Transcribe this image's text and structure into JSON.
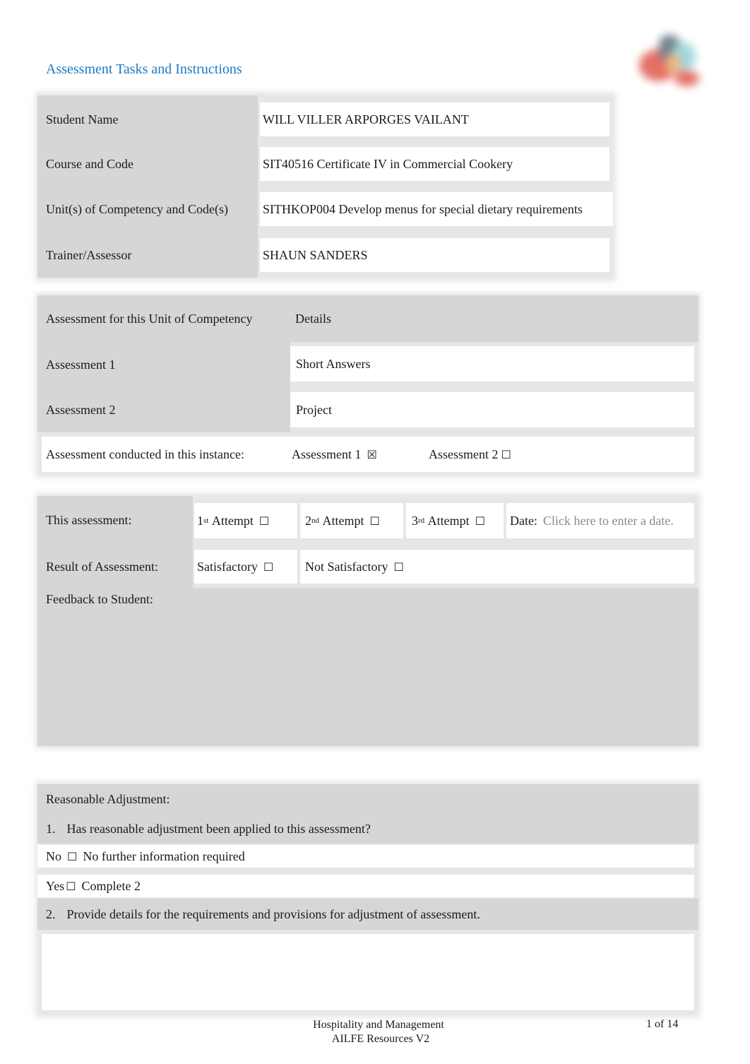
{
  "header": {
    "title": "Assessment Tasks and Instructions",
    "logo_icon": "organisation-logo"
  },
  "details_table": {
    "rows": [
      {
        "label": "Student Name",
        "value": "WILL VILLER ARPORGES VAILANT"
      },
      {
        "label": "Course and Code",
        "value": "SIT40516 Certificate IV in Commercial Cookery"
      },
      {
        "label": "Unit(s) of Competency and Code(s)",
        "value": "SITHKOP004 Develop menus for special dietary requirements"
      },
      {
        "label": "Trainer/Assessor",
        "value": "SHAUN SANDERS"
      }
    ]
  },
  "assessment_table": {
    "header": {
      "label": "Assessment for this Unit of Competency",
      "value": "Details"
    },
    "rows": [
      {
        "label": "Assessment 1",
        "value": "Short Answers"
      },
      {
        "label": "Assessment 2",
        "value": "Project"
      }
    ],
    "conducted": {
      "label": "Assessment conducted in this instance:",
      "options": [
        {
          "label": "Assessment 1",
          "checked": true,
          "box": "☒"
        },
        {
          "label": "Assessment 2",
          "checked": false,
          "box": "☐"
        }
      ]
    }
  },
  "result_table": {
    "attempt_label": "This assessment:",
    "attempts": [
      {
        "num": "1",
        "sup": "st",
        "label": "Attempt",
        "checked": false,
        "box": "☐"
      },
      {
        "num": "2",
        "sup": "nd",
        "label": "Attempt",
        "checked": false,
        "box": "☐"
      },
      {
        "num": "3",
        "sup": "rd",
        "label": "Attempt",
        "checked": false,
        "box": "☐"
      }
    ],
    "date_label": "Date:",
    "date_placeholder": "Click here to enter a date.",
    "result_label": "Result of Assessment:",
    "results": [
      {
        "label": "Satisfactory",
        "checked": false,
        "box": "☐"
      },
      {
        "label": "Not Satisfactory",
        "checked": false,
        "box": "☐"
      }
    ],
    "feedback_label": "Feedback to Student:",
    "feedback_value": ""
  },
  "adjustment_table": {
    "title": "Reasonable Adjustment:",
    "q1": {
      "num": "1.",
      "text": "Has reasonable adjustment been applied to this assessment?"
    },
    "no_option": {
      "label": "No",
      "box": "☐",
      "checked": false,
      "note": "No further information required"
    },
    "yes_option": {
      "label": "Yes",
      "box": "☐",
      "checked": false,
      "note": "Complete 2"
    },
    "q2": {
      "num": "2.",
      "text": "Provide details for the requirements and provisions for adjustment of assessment."
    },
    "details_value": ""
  },
  "footer": {
    "line1": "Hospitality and Management",
    "line2": "AILFE Resources V2",
    "page": "1 of 14"
  }
}
